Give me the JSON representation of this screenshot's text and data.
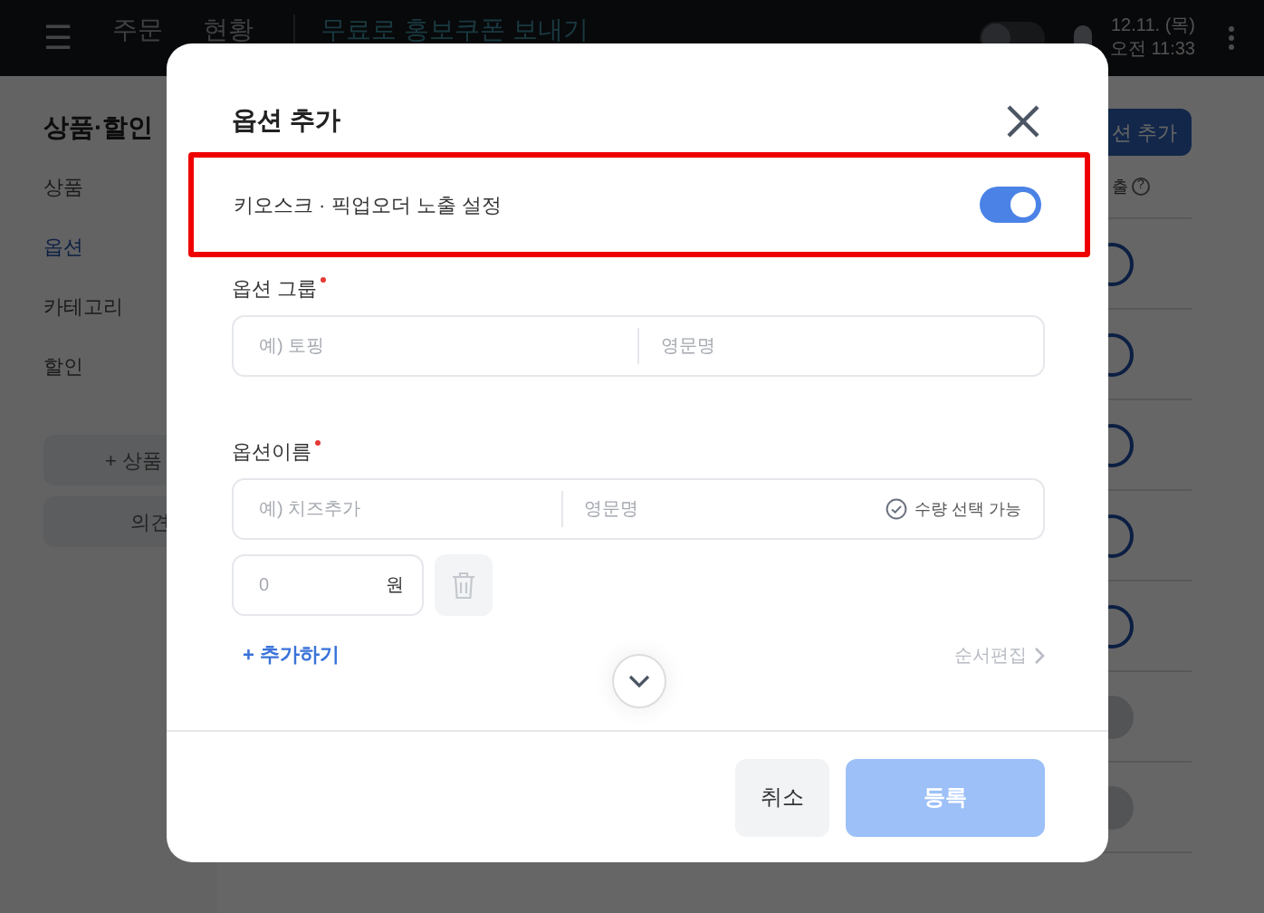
{
  "top_bar": {
    "menu": "☰",
    "tabs": [
      {
        "label": "주문",
        "selected": false
      },
      {
        "label": "현황",
        "selected": false
      }
    ],
    "banner": "무료로 홍보쿠폰 보내기",
    "date": "12.11. (목)",
    "time": "오전 11:33"
  },
  "sidebar": {
    "title": "상품·할인",
    "items": [
      {
        "label": "상품",
        "selected": false
      },
      {
        "label": "옵션",
        "selected": true
      },
      {
        "label": "카테고리",
        "selected": false
      },
      {
        "label": "할인",
        "selected": false
      }
    ],
    "buttons": [
      "+ 상품",
      "의견"
    ]
  },
  "content": {
    "add_button": "션 추가",
    "column_label": "출",
    "help_mark": "?",
    "rows": [
      {
        "on": true
      },
      {
        "on": true
      },
      {
        "on": true
      },
      {
        "on": true
      },
      {
        "on": true
      },
      {
        "on": false
      },
      {
        "on": false
      }
    ]
  },
  "modal": {
    "title": "옵션 추가",
    "kiosk_setting": {
      "label": "키오스크 · 픽업오더 노출 설정",
      "on": true
    },
    "group": {
      "label": "옵션 그룹",
      "required": true,
      "placeholder": "예) 토핑",
      "english_placeholder": "영문명"
    },
    "option": {
      "label": "옵션이름",
      "required": true,
      "placeholder": "예) 치즈추가",
      "english_placeholder": "영문명",
      "quantity_label": "수량 선택 가능",
      "price_placeholder": "0",
      "currency": "원"
    },
    "add_link": "+ 추가하기",
    "reorder_link": "순서편집",
    "cancel": "취소",
    "submit": "등록",
    "submit_disabled": true
  }
}
